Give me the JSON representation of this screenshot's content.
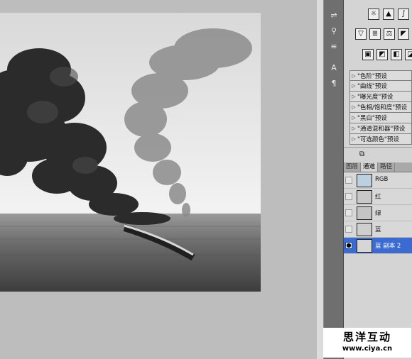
{
  "adjustments": {
    "presets": [
      "\"色阶\"预设",
      "\"曲线\"预设",
      "\"曝光度\"预设",
      "\"色相/饱和度\"预设",
      "\"黑白\"预设",
      "\"通道混和器\"预设",
      "\"可选颜色\"预设"
    ]
  },
  "layers_panel": {
    "tabs": [
      "图层",
      "通道",
      "路径"
    ],
    "active_tab": "通道",
    "channels": [
      {
        "name": "RGB",
        "visible": false,
        "selected": false
      },
      {
        "name": "红",
        "visible": false,
        "selected": false
      },
      {
        "name": "绿",
        "visible": false,
        "selected": false
      },
      {
        "name": "蓝",
        "visible": false,
        "selected": false
      },
      {
        "name": "蓝 副本 2",
        "visible": true,
        "selected": true
      }
    ]
  },
  "watermark": {
    "title": "思洋互动",
    "url": "www.ciya.cn"
  },
  "colors": {
    "canvas_bg": "#bdbdbd",
    "panel_bg": "#d4d4d4",
    "selection": "#3b6bd0",
    "toolstrip": "#6f6f6f"
  }
}
